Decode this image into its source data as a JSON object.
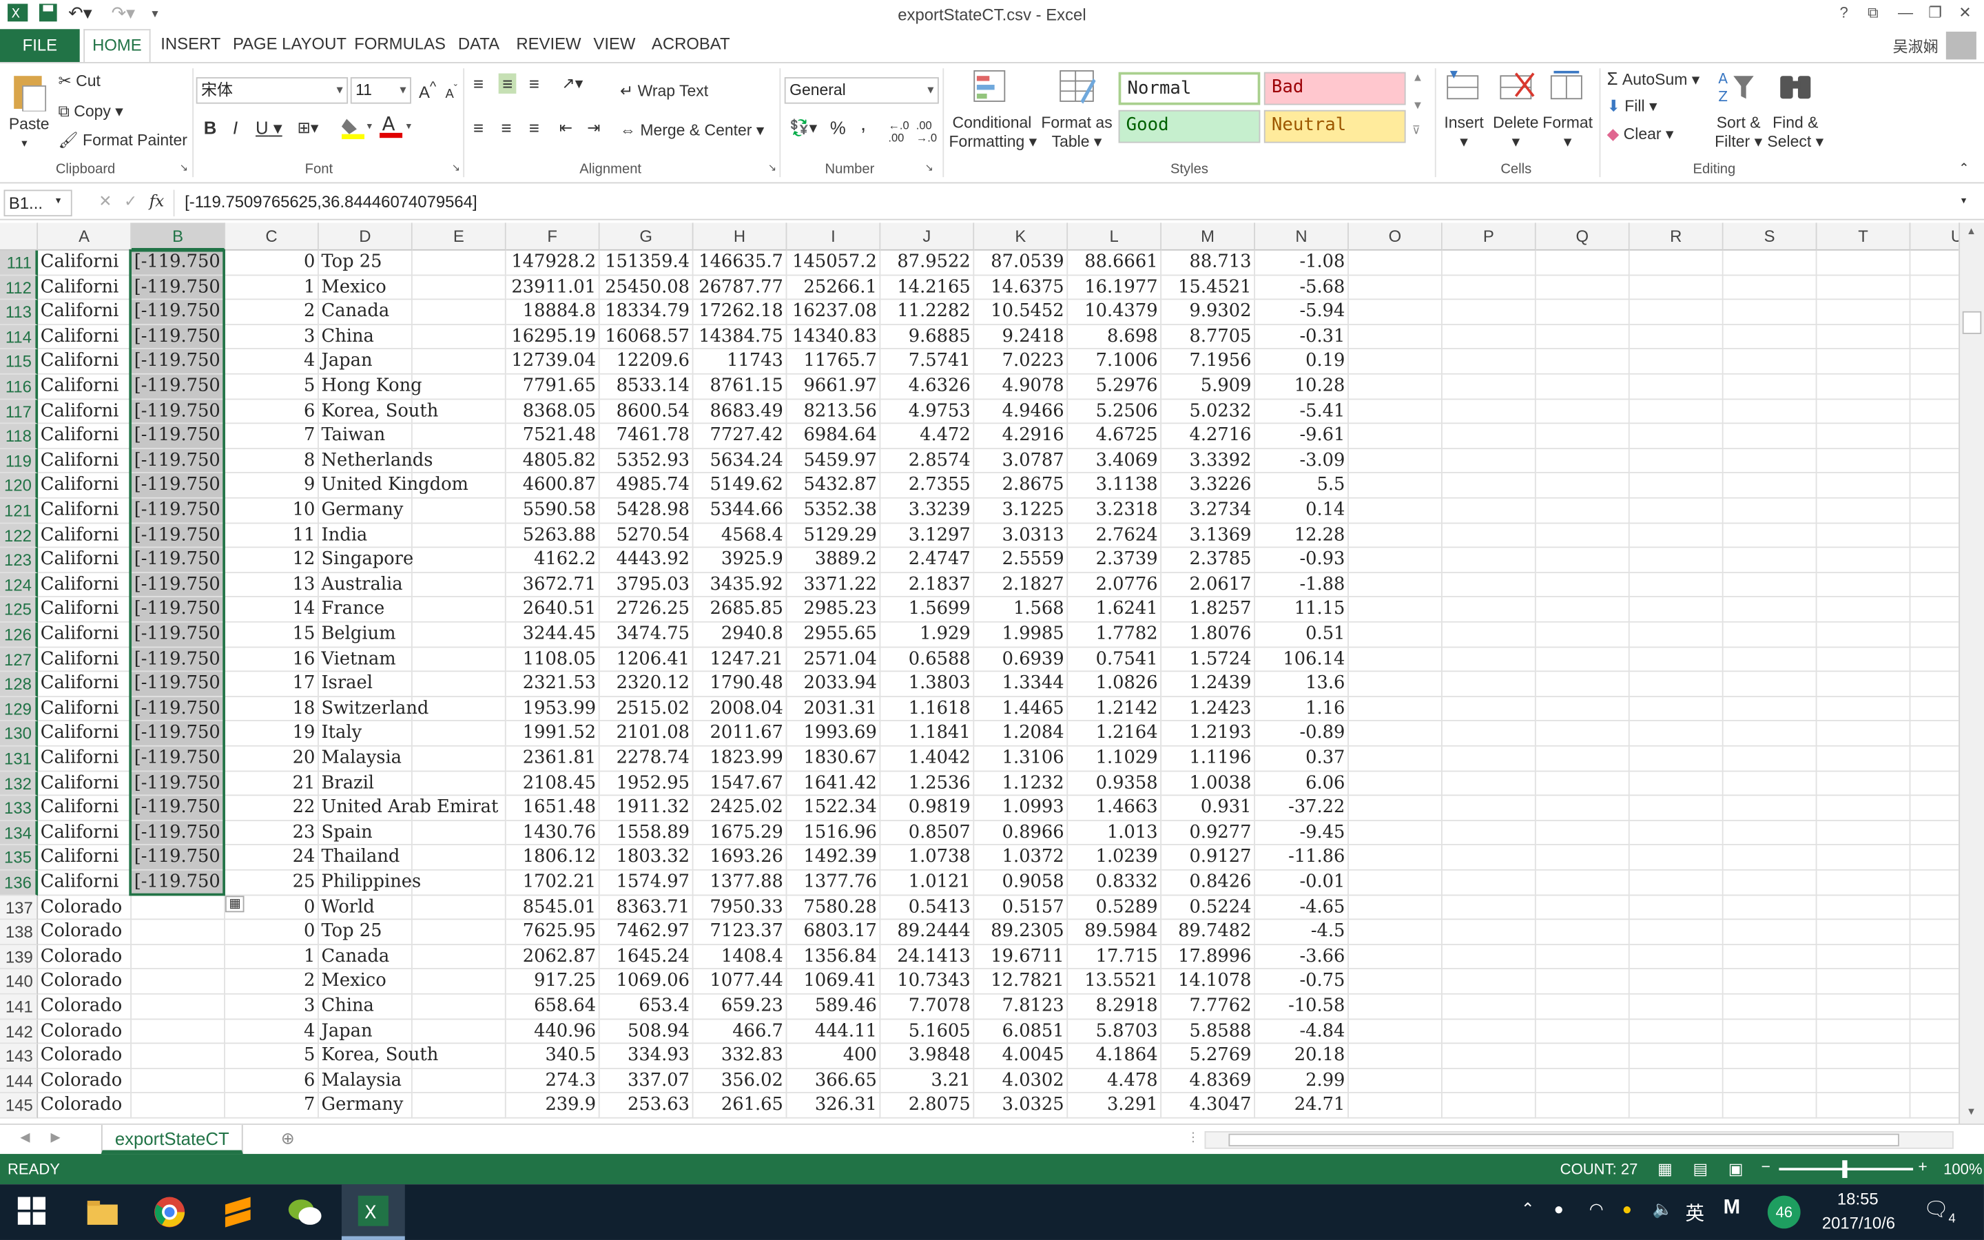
{
  "window": {
    "title": "exportStateCT.csv - Excel",
    "help": "?",
    "ctrl": [
      "⧉",
      "—",
      "❐",
      "✕"
    ]
  },
  "tabs": [
    "FILE",
    "HOME",
    "INSERT",
    "PAGE LAYOUT",
    "FORMULAS",
    "DATA",
    "REVIEW",
    "VIEW",
    "ACROBAT"
  ],
  "user": "吴淑娴",
  "clipboard": {
    "paste": "Paste",
    "cut": "Cut",
    "copy": "Copy",
    "format_painter": "Format Painter",
    "label": "Clipboard"
  },
  "font": {
    "name": "宋体",
    "size": "11",
    "bold": "B",
    "italic": "I",
    "underline": "U",
    "grow": "A",
    "shrink": "A",
    "label": "Font"
  },
  "alignment": {
    "wrap": "Wrap Text",
    "merge": "Merge & Center",
    "label": "Alignment"
  },
  "number": {
    "format": "General",
    "percent": "%",
    "comma": ",",
    "label": "Number"
  },
  "styles": {
    "cond": "Conditional",
    "cond2": "Formatting",
    "fmt_table": "Format as",
    "fmt_table2": "Table",
    "normal": "Normal",
    "bad": "Bad",
    "good": "Good",
    "neutral": "Neutral",
    "label": "Styles"
  },
  "cells": {
    "insert": "Insert",
    "delete": "Delete",
    "format": "Format",
    "label": "Cells"
  },
  "editing": {
    "autosum": "AutoSum",
    "fill": "Fill",
    "clear": "Clear",
    "sort": "Sort &",
    "sort2": "Filter",
    "find": "Find &",
    "find2": "Select",
    "label": "Editing"
  },
  "formula_bar": {
    "namebox": "B1...",
    "fx": "fx",
    "value": "[-119.7509765625,36.84446074079564]"
  },
  "columns": [
    "A",
    "B",
    "C",
    "D",
    "E",
    "F",
    "G",
    "H",
    "I",
    "J",
    "K",
    "L",
    "M",
    "N",
    "O",
    "P",
    "Q",
    "R",
    "S",
    "T",
    "U"
  ],
  "rows": [
    [
      "111",
      "Californi",
      "[-119.750",
      "0",
      "Top 25",
      "",
      "147928.2",
      "151359.4",
      "146635.7",
      "145057.2",
      "87.9522",
      "87.0539",
      "88.6661",
      "88.713",
      "-1.08"
    ],
    [
      "112",
      "Californi",
      "[-119.750",
      "1",
      "Mexico",
      "",
      "23911.01",
      "25450.08",
      "26787.77",
      "25266.1",
      "14.2165",
      "14.6375",
      "16.1977",
      "15.4521",
      "-5.68"
    ],
    [
      "113",
      "Californi",
      "[-119.750",
      "2",
      "Canada",
      "",
      "18884.8",
      "18334.79",
      "17262.18",
      "16237.08",
      "11.2282",
      "10.5452",
      "10.4379",
      "9.9302",
      "-5.94"
    ],
    [
      "114",
      "Californi",
      "[-119.750",
      "3",
      "China",
      "",
      "16295.19",
      "16068.57",
      "14384.75",
      "14340.83",
      "9.6885",
      "9.2418",
      "8.698",
      "8.7705",
      "-0.31"
    ],
    [
      "115",
      "Californi",
      "[-119.750",
      "4",
      "Japan",
      "",
      "12739.04",
      "12209.6",
      "11743",
      "11765.7",
      "7.5741",
      "7.0223",
      "7.1006",
      "7.1956",
      "0.19"
    ],
    [
      "116",
      "Californi",
      "[-119.750",
      "5",
      "Hong Kong",
      "",
      "7791.65",
      "8533.14",
      "8761.15",
      "9661.97",
      "4.6326",
      "4.9078",
      "5.2976",
      "5.909",
      "10.28"
    ],
    [
      "117",
      "Californi",
      "[-119.750",
      "6",
      "Korea, South",
      "",
      "8368.05",
      "8600.54",
      "8683.49",
      "8213.56",
      "4.9753",
      "4.9466",
      "5.2506",
      "5.0232",
      "-5.41"
    ],
    [
      "118",
      "Californi",
      "[-119.750",
      "7",
      "Taiwan",
      "",
      "7521.48",
      "7461.78",
      "7727.42",
      "6984.64",
      "4.472",
      "4.2916",
      "4.6725",
      "4.2716",
      "-9.61"
    ],
    [
      "119",
      "Californi",
      "[-119.750",
      "8",
      "Netherlands",
      "",
      "4805.82",
      "5352.93",
      "5634.24",
      "5459.97",
      "2.8574",
      "3.0787",
      "3.4069",
      "3.3392",
      "-3.09"
    ],
    [
      "120",
      "Californi",
      "[-119.750",
      "9",
      "United Kingdom",
      "",
      "4600.87",
      "4985.74",
      "5149.62",
      "5432.87",
      "2.7355",
      "2.8675",
      "3.1138",
      "3.3226",
      "5.5"
    ],
    [
      "121",
      "Californi",
      "[-119.750",
      "10",
      "Germany",
      "",
      "5590.58",
      "5428.98",
      "5344.66",
      "5352.38",
      "3.3239",
      "3.1225",
      "3.2318",
      "3.2734",
      "0.14"
    ],
    [
      "122",
      "Californi",
      "[-119.750",
      "11",
      "India",
      "",
      "5263.88",
      "5270.54",
      "4568.4",
      "5129.29",
      "3.1297",
      "3.0313",
      "2.7624",
      "3.1369",
      "12.28"
    ],
    [
      "123",
      "Californi",
      "[-119.750",
      "12",
      "Singapore",
      "",
      "4162.2",
      "4443.92",
      "3925.9",
      "3889.2",
      "2.4747",
      "2.5559",
      "2.3739",
      "2.3785",
      "-0.93"
    ],
    [
      "124",
      "Californi",
      "[-119.750",
      "13",
      "Australia",
      "",
      "3672.71",
      "3795.03",
      "3435.92",
      "3371.22",
      "2.1837",
      "2.1827",
      "2.0776",
      "2.0617",
      "-1.88"
    ],
    [
      "125",
      "Californi",
      "[-119.750",
      "14",
      "France",
      "",
      "2640.51",
      "2726.25",
      "2685.85",
      "2985.23",
      "1.5699",
      "1.568",
      "1.6241",
      "1.8257",
      "11.15"
    ],
    [
      "126",
      "Californi",
      "[-119.750",
      "15",
      "Belgium",
      "",
      "3244.45",
      "3474.75",
      "2940.8",
      "2955.65",
      "1.929",
      "1.9985",
      "1.7782",
      "1.8076",
      "0.51"
    ],
    [
      "127",
      "Californi",
      "[-119.750",
      "16",
      "Vietnam",
      "",
      "1108.05",
      "1206.41",
      "1247.21",
      "2571.04",
      "0.6588",
      "0.6939",
      "0.7541",
      "1.5724",
      "106.14"
    ],
    [
      "128",
      "Californi",
      "[-119.750",
      "17",
      "Israel",
      "",
      "2321.53",
      "2320.12",
      "1790.48",
      "2033.94",
      "1.3803",
      "1.3344",
      "1.0826",
      "1.2439",
      "13.6"
    ],
    [
      "129",
      "Californi",
      "[-119.750",
      "18",
      "Switzerland",
      "",
      "1953.99",
      "2515.02",
      "2008.04",
      "2031.31",
      "1.1618",
      "1.4465",
      "1.2142",
      "1.2423",
      "1.16"
    ],
    [
      "130",
      "Californi",
      "[-119.750",
      "19",
      "Italy",
      "",
      "1991.52",
      "2101.08",
      "2011.67",
      "1993.69",
      "1.1841",
      "1.2084",
      "1.2164",
      "1.2193",
      "-0.89"
    ],
    [
      "131",
      "Californi",
      "[-119.750",
      "20",
      "Malaysia",
      "",
      "2361.81",
      "2278.74",
      "1823.99",
      "1830.67",
      "1.4042",
      "1.3106",
      "1.1029",
      "1.1196",
      "0.37"
    ],
    [
      "132",
      "Californi",
      "[-119.750",
      "21",
      "Brazil",
      "",
      "2108.45",
      "1952.95",
      "1547.67",
      "1641.42",
      "1.2536",
      "1.1232",
      "0.9358",
      "1.0038",
      "6.06"
    ],
    [
      "133",
      "Californi",
      "[-119.750",
      "22",
      "United Arab Emirat",
      "",
      "1651.48",
      "1911.32",
      "2425.02",
      "1522.34",
      "0.9819",
      "1.0993",
      "1.4663",
      "0.931",
      "-37.22"
    ],
    [
      "134",
      "Californi",
      "[-119.750",
      "23",
      "Spain",
      "",
      "1430.76",
      "1558.89",
      "1675.29",
      "1516.96",
      "0.8507",
      "0.8966",
      "1.013",
      "0.9277",
      "-9.45"
    ],
    [
      "135",
      "Californi",
      "[-119.750",
      "24",
      "Thailand",
      "",
      "1806.12",
      "1803.32",
      "1693.26",
      "1492.39",
      "1.0738",
      "1.0372",
      "1.0239",
      "0.9127",
      "-11.86"
    ],
    [
      "136",
      "Californi",
      "[-119.750",
      "25",
      "Philippines",
      "",
      "1702.21",
      "1574.97",
      "1377.88",
      "1377.76",
      "1.0121",
      "0.9058",
      "0.8332",
      "0.8426",
      "-0.01"
    ],
    [
      "137",
      "Colorado",
      "",
      "0",
      "World",
      "",
      "8545.01",
      "8363.71",
      "7950.33",
      "7580.28",
      "0.5413",
      "0.5157",
      "0.5289",
      "0.5224",
      "-4.65"
    ],
    [
      "138",
      "Colorado",
      "",
      "0",
      "Top 25",
      "",
      "7625.95",
      "7462.97",
      "7123.37",
      "6803.17",
      "89.2444",
      "89.2305",
      "89.5984",
      "89.7482",
      "-4.5"
    ],
    [
      "139",
      "Colorado",
      "",
      "1",
      "Canada",
      "",
      "2062.87",
      "1645.24",
      "1408.4",
      "1356.84",
      "24.1413",
      "19.6711",
      "17.715",
      "17.8996",
      "-3.66"
    ],
    [
      "140",
      "Colorado",
      "",
      "2",
      "Mexico",
      "",
      "917.25",
      "1069.06",
      "1077.44",
      "1069.41",
      "10.7343",
      "12.7821",
      "13.5521",
      "14.1078",
      "-0.75"
    ],
    [
      "141",
      "Colorado",
      "",
      "3",
      "China",
      "",
      "658.64",
      "653.4",
      "659.23",
      "589.46",
      "7.7078",
      "7.8123",
      "8.2918",
      "7.7762",
      "-10.58"
    ],
    [
      "142",
      "Colorado",
      "",
      "4",
      "Japan",
      "",
      "440.96",
      "508.94",
      "466.7",
      "444.11",
      "5.1605",
      "6.0851",
      "5.8703",
      "5.8588",
      "-4.84"
    ],
    [
      "143",
      "Colorado",
      "",
      "5",
      "Korea, South",
      "",
      "340.5",
      "334.93",
      "332.83",
      "400",
      "3.9848",
      "4.0045",
      "4.1864",
      "5.2769",
      "20.18"
    ],
    [
      "144",
      "Colorado",
      "",
      "6",
      "Malaysia",
      "",
      "274.3",
      "337.07",
      "356.02",
      "366.65",
      "3.21",
      "4.0302",
      "4.478",
      "4.8369",
      "2.99"
    ],
    [
      "145",
      "Colorado",
      "",
      "7",
      "Germany",
      "",
      "239.9",
      "253.63",
      "261.65",
      "326.31",
      "2.8075",
      "3.0325",
      "3.291",
      "4.3047",
      "24.71"
    ]
  ],
  "sheet_tab": "exportStateCT",
  "status": {
    "ready": "READY",
    "count": "COUNT: 27",
    "zoom": "100%"
  },
  "taskbar": {
    "time": "18:55",
    "date": "2017/10/6",
    "ime": "英",
    "badge": "46",
    "notif": "4"
  }
}
